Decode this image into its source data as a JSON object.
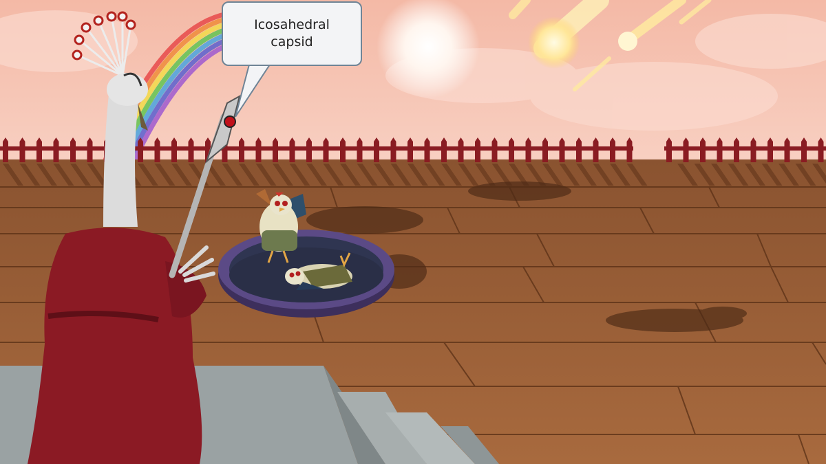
{
  "speech_bubble": {
    "text": "Icosahedral capsid"
  },
  "colors": {
    "sky": "#f6c2b0",
    "deck": "#9a5f37",
    "fence": "#8a1c22",
    "robe": "#8b1a24",
    "dish": "#5b4a86"
  }
}
